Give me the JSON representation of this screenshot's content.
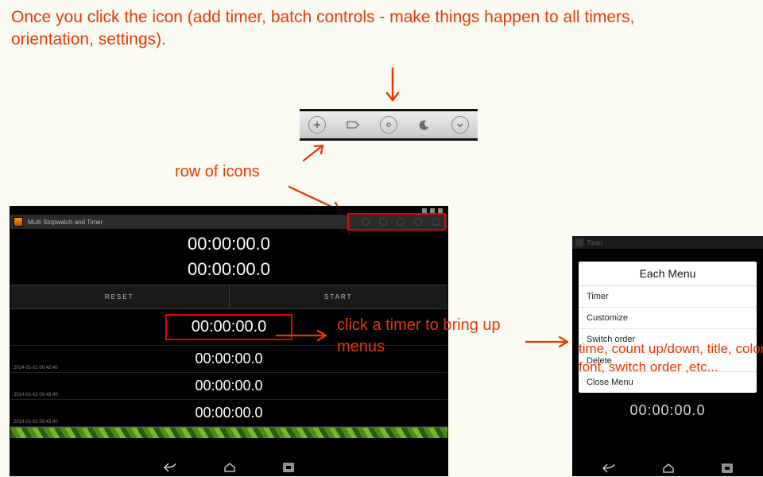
{
  "annotations": {
    "top": "Once you click the icon (add timer, batch controls - make things happen to all timers,  orientation, settings).",
    "row_of_icons": "row of icons",
    "click_timer": "click a timer to bring up menus",
    "menu_details": "time, count up/down, title, color, font, switch order ,etc..."
  },
  "toolbar_icons": [
    "add-icon",
    "tag-icon",
    "gear-icon",
    "moon-icon",
    "down-icon"
  ],
  "app": {
    "title": "Multi Stopwatch and Timer",
    "top_times": [
      "00:00:00.0",
      "00:00:00.0"
    ],
    "buttons": {
      "reset": "RESET",
      "start": "START"
    },
    "timers": [
      {
        "value": "00:00:00.0",
        "selected": true
      },
      {
        "value": "00:00:00.0",
        "date": "2014-01-02 00:42:40"
      },
      {
        "value": "00:00:00.0",
        "date": "2014-01-02 00:43:40"
      },
      {
        "value": "00:00:00.0",
        "date": "2014-01-02 00:43:40"
      }
    ]
  },
  "menu": {
    "title": "Each Menu",
    "items": [
      "Timer",
      "Customize",
      "Switch order",
      "Delete",
      "Close Menu"
    ],
    "under_time": "00:00:00.0"
  }
}
